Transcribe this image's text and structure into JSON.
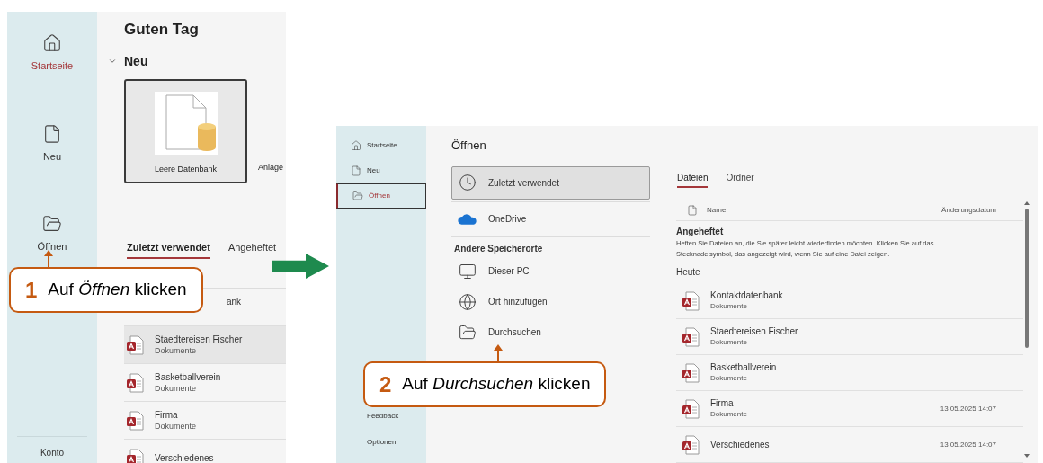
{
  "left_screen": {
    "sidebar": [
      {
        "label": "Startseite",
        "selected": true
      },
      {
        "label": "Neu",
        "selected": false
      },
      {
        "label": "Öffnen",
        "selected": false
      }
    ],
    "sidebar_footer": "Konto",
    "greeting": "Guten Tag",
    "new_section": {
      "title": "Neu",
      "expanded": true,
      "templates": [
        {
          "label": "Leere Datenbank",
          "selected": true
        },
        {
          "label": "Anlage",
          "selected": false
        }
      ]
    },
    "tabs": [
      {
        "label": "Zuletzt verwendet",
        "selected": true
      },
      {
        "label": "Angeheftet",
        "selected": false
      }
    ],
    "covered_file_text": "ank",
    "files": [
      {
        "name": "Staedtereisen Fischer",
        "location": "Dokumente",
        "selected": true
      },
      {
        "name": "Basketballverein",
        "location": "Dokumente",
        "selected": false
      },
      {
        "name": "Firma",
        "location": "Dokumente",
        "selected": false
      },
      {
        "name": "Verschiedenes",
        "selected": false
      }
    ]
  },
  "right_screen": {
    "sidebar": [
      {
        "label": "Startseite",
        "selected": false
      },
      {
        "label": "Neu",
        "selected": false
      },
      {
        "label": "Öffnen",
        "selected": true
      }
    ],
    "sidebar_footer": [
      "Feedback",
      "Optionen"
    ],
    "title": "Öffnen",
    "places": [
      {
        "label": "Zuletzt verwendet",
        "selected": true
      },
      {
        "label": "OneDrive",
        "selected": false
      }
    ],
    "other_places_heading": "Andere Speicherorte",
    "other_places": [
      {
        "label": "Dieser PC",
        "selected": false
      },
      {
        "label": "Ort hinzufügen",
        "selected": false
      },
      {
        "label": "Durchsuchen",
        "selected": false
      }
    ],
    "tabs": [
      {
        "label": "Dateien",
        "selected": true
      },
      {
        "label": "Ordner",
        "selected": false
      }
    ],
    "columns": [
      "Name",
      "Änderungsdatum"
    ],
    "pinned_heading": "Angeheftet",
    "pinned_hint": "Heften Sie Dateien an, die Sie später leicht wiederfinden möchten. Klicken Sie auf das Stecknadelsymbol, das angezeigt wird, wenn Sie auf eine Datei zeigen.",
    "group_heading": "Heute",
    "files": [
      {
        "name": "Kontaktdatenbank",
        "location": "Dokumente"
      },
      {
        "name": "Staedtereisen Fischer",
        "location": "Dokumente"
      },
      {
        "name": "Basketballverein",
        "location": "Dokumente"
      },
      {
        "name": "Firma",
        "location": "Dokumente",
        "date": "13.05.2025 14:07"
      },
      {
        "name": "Verschiedenes",
        "date": "13.05.2025 14:07"
      }
    ]
  },
  "callouts": [
    {
      "number": "1",
      "text": "Auf *Öffnen* klicken"
    },
    {
      "number": "2",
      "text": "Auf *Durchsuchen* klicken"
    }
  ]
}
